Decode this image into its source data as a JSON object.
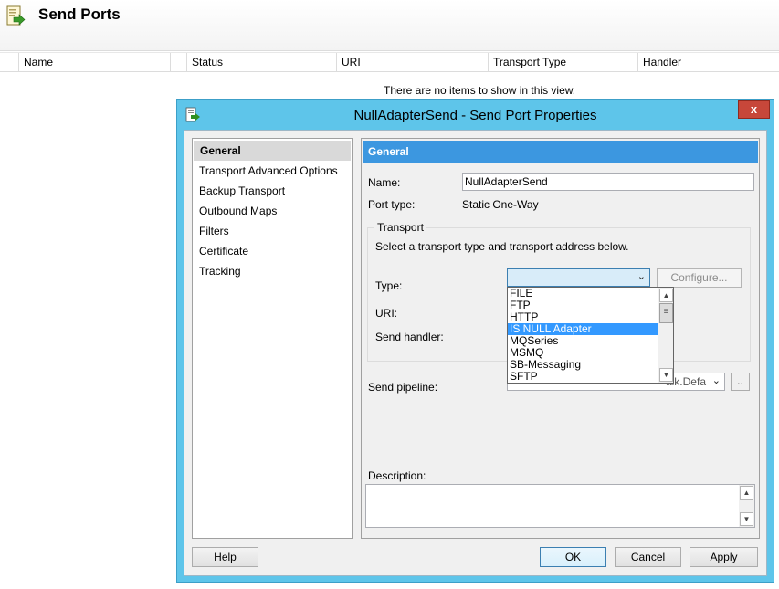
{
  "page": {
    "title": "Send Ports",
    "columns": [
      "Name",
      "Status",
      "URI",
      "Transport Type",
      "Handler"
    ],
    "empty_message": "There are no items to show in this view."
  },
  "dialog": {
    "title": "NullAdapterSend - Send Port Properties",
    "close_label": "x",
    "nav_items": [
      "General",
      "Transport Advanced Options",
      "Backup Transport",
      "Outbound Maps",
      "Filters",
      "Certificate",
      "Tracking"
    ],
    "selected_nav": "General",
    "section_header": "General",
    "name_label": "Name:",
    "name_value": "NullAdapterSend",
    "port_type_label": "Port type:",
    "port_type_value": "Static One-Way",
    "transport": {
      "group_title": "Transport",
      "instruction": "Select a transport type and transport address below.",
      "type_label": "Type:",
      "type_value": "",
      "configure_label": "Configure...",
      "uri_label": "URI:",
      "send_handler_label": "Send handler:",
      "type_options": [
        "FILE",
        "FTP",
        "HTTP",
        "IS NULL Adapter",
        "MQSeries",
        "MSMQ",
        "SB-Messaging",
        "SFTP"
      ],
      "highlighted_option": "IS NULL Adapter"
    },
    "send_pipeline_label": "Send pipeline:",
    "send_pipeline_value": "alk.Defa",
    "browse_label": "..",
    "description_label": "Description:",
    "description_value": "",
    "buttons": {
      "help": "Help",
      "ok": "OK",
      "cancel": "Cancel",
      "apply": "Apply"
    }
  },
  "colors": {
    "title_bar": "#5ec5ea",
    "section_header": "#3c97e0",
    "close_button": "#c7473a",
    "highlight": "#3399ff"
  },
  "icons": {
    "app": "send-port-icon",
    "dialog": "send-port-icon",
    "close": "close-icon"
  }
}
